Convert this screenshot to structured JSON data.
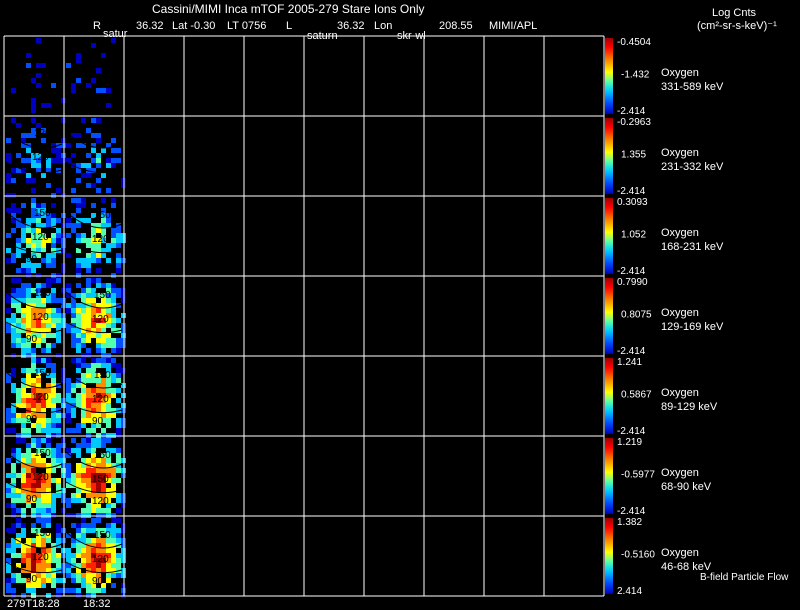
{
  "header": {
    "title": "Cassini/MIMI Inca mTOF  2005-279   Stare   Ions Only",
    "line2": {
      "r_label": "R",
      "r_value": "36.32",
      "lat": "Lat -0.30",
      "lt": "LT 0756",
      "l_label": "L",
      "l_value": "36.32",
      "lon": "Lon",
      "lon_value": "208.55",
      "org": "MIMI/APL"
    },
    "overlay_labels": [
      "satur",
      "saturn",
      "skr-wl"
    ]
  },
  "colorbar_title": {
    "line1": "Log Cnts",
    "line2": "(cm²-sr-s-keV)⁻¹"
  },
  "footer": {
    "time_labels": [
      "279T18:28",
      "18:32"
    ],
    "note": "B-field Particle Flow"
  },
  "colors": {
    "background": "#000000",
    "grid": "#ffffff",
    "colormap": [
      "#0000c0",
      "#0050ff",
      "#00c8ff",
      "#50ffb0",
      "#ffff00",
      "#ff8c00",
      "#ff2000",
      "#a00000"
    ]
  },
  "chart_data": {
    "type": "heatmap",
    "grid": {
      "columns": 10,
      "rows_per_panel": 1,
      "grid_lines": true
    },
    "panels": [
      {
        "species": "Oxygen",
        "energy": "331-589 keV",
        "cbar_max": "-0.4504",
        "cbar_mid": "-1.432",
        "cbar_min": "-2.414",
        "intensity": 0.08,
        "contours": []
      },
      {
        "species": "Oxygen",
        "energy": "231-332 keV",
        "cbar_max": "-0.2963",
        "cbar_mid": "1.355",
        "cbar_min": "-2.414",
        "intensity": 0.25,
        "contours": [
          "120",
          "120"
        ]
      },
      {
        "species": "Oxygen",
        "energy": "168-231 keV",
        "cbar_max": "0.3093",
        "cbar_mid": "1.052",
        "cbar_min": "-2.414",
        "intensity": 0.5,
        "contours": [
          "150",
          "120",
          "90",
          "150",
          "120"
        ]
      },
      {
        "species": "Oxygen",
        "energy": "129-169 keV",
        "cbar_max": "0.7990",
        "cbar_mid": "0.8075",
        "cbar_min": "-2.414",
        "intensity": 0.7,
        "contours": [
          "150",
          "120",
          "90",
          "150",
          "120"
        ]
      },
      {
        "species": "Oxygen",
        "energy": "89-129 keV",
        "cbar_max": "1.241",
        "cbar_mid": "0.5867",
        "cbar_min": "-2.414",
        "intensity": 0.8,
        "contours": [
          "150",
          "120",
          "90",
          "150",
          "120",
          "90"
        ]
      },
      {
        "species": "Oxygen",
        "energy": "68-90 keV",
        "cbar_max": "1.219",
        "cbar_mid": "-0.5977",
        "cbar_min": "-2.414",
        "intensity": 0.88,
        "contours": [
          "150",
          "120",
          "90",
          "150",
          "150",
          "120"
        ]
      },
      {
        "species": "Oxygen",
        "energy": "46-68 keV",
        "cbar_max": "1.382",
        "cbar_mid": "-0.5160",
        "cbar_min": "2.414",
        "intensity": 0.85,
        "contours": [
          "150",
          "120",
          "90",
          "150",
          "120",
          "90"
        ]
      }
    ]
  }
}
